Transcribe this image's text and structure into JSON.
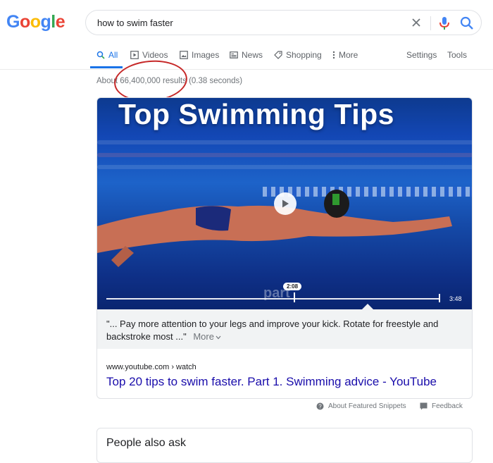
{
  "logo": {
    "letters": [
      "G",
      "o",
      "o",
      "g",
      "l",
      "e"
    ],
    "colors": [
      "#4285F4",
      "#EA4335",
      "#FBBC05",
      "#4285F4",
      "#34A853",
      "#EA4335"
    ]
  },
  "search": {
    "query": "how to swim faster"
  },
  "tabs": {
    "all": "All",
    "videos": "Videos",
    "images": "Images",
    "news": "News",
    "shopping": "Shopping",
    "more": "More",
    "settings": "Settings",
    "tools": "Tools"
  },
  "result_stats": "About 66,400,000 results (0.38 seconds)",
  "featured_snippet": {
    "video": {
      "title": "Top Swimming Tips",
      "watermark": "part",
      "timestamp": "2:08",
      "duration": "3:48"
    },
    "snippet_text": "\"... Pay more attention to your legs and improve your kick. Rotate for freestyle and backstroke most ...\"",
    "more_label": "More",
    "source": "www.youtube.com › watch",
    "title": "Top 20 tips to swim faster. Part 1. Swimming advice - YouTube"
  },
  "footer": {
    "about": "About Featured Snippets",
    "feedback": "Feedback"
  },
  "people_also_ask": {
    "title": "People also ask"
  },
  "colors": {
    "accent": "#1a73e8",
    "link": "#1a0dab",
    "annotation": "#c62828"
  }
}
